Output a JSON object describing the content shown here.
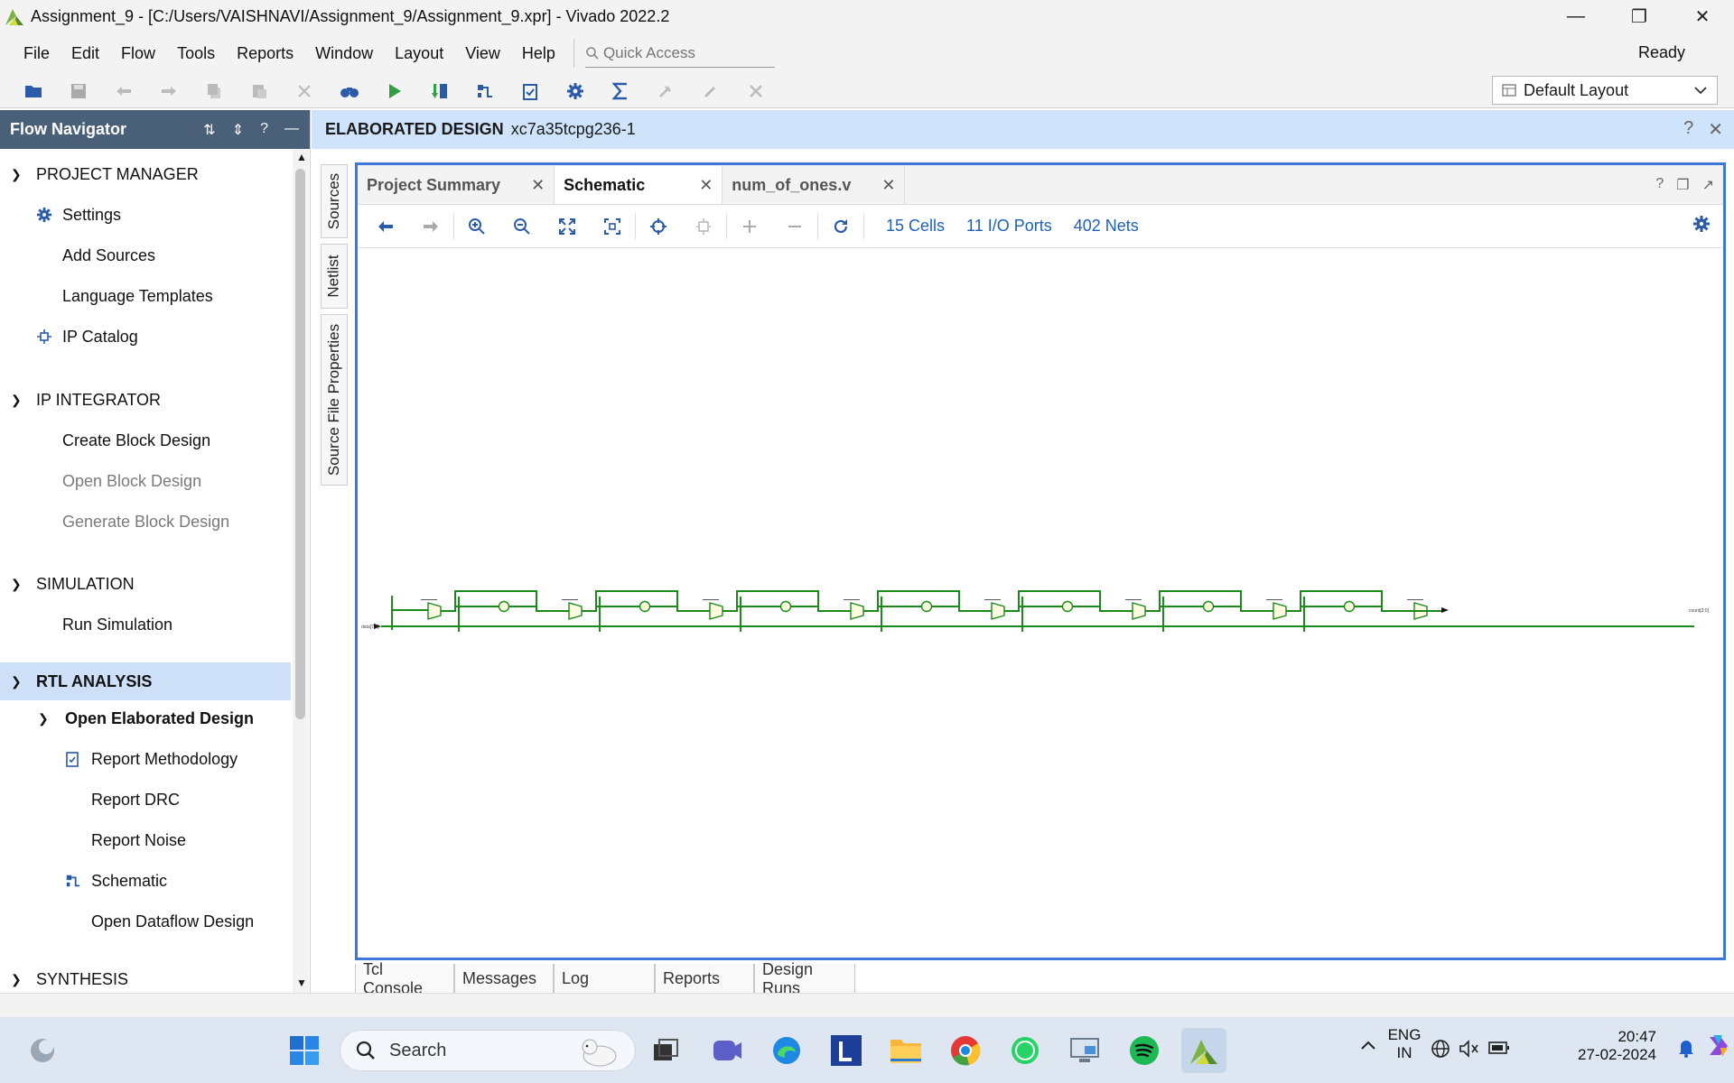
{
  "window": {
    "title": "Assignment_9 - [C:/Users/VAISHNAVI/Assignment_9/Assignment_9.xpr] - Vivado 2022.2"
  },
  "menu": [
    "File",
    "Edit",
    "Flow",
    "Tools",
    "Reports",
    "Window",
    "Layout",
    "View",
    "Help"
  ],
  "quick_access": {
    "placeholder": "Quick Access"
  },
  "status": "Ready",
  "layout_select": {
    "value": "Default Layout"
  },
  "flow_navigator": {
    "title": "Flow Navigator",
    "sections": {
      "project_manager": {
        "label": "PROJECT MANAGER",
        "items": [
          "Settings",
          "Add Sources",
          "Language Templates",
          "IP Catalog"
        ]
      },
      "ip_integrator": {
        "label": "IP INTEGRATOR",
        "items": [
          "Create Block Design",
          "Open Block Design",
          "Generate Block Design"
        ]
      },
      "simulation": {
        "label": "SIMULATION",
        "items": [
          "Run Simulation"
        ]
      },
      "rtl_analysis": {
        "label": "RTL ANALYSIS",
        "sub": "Open Elaborated Design",
        "items": [
          "Report Methodology",
          "Report DRC",
          "Report Noise",
          "Schematic",
          "Open Dataflow Design"
        ]
      },
      "synthesis": {
        "label": "SYNTHESIS"
      }
    }
  },
  "elaborated": {
    "title": "ELABORATED DESIGN",
    "part": "xc7a35tcpg236-1"
  },
  "side_tabs": [
    "Sources",
    "Netlist",
    "Source File Properties"
  ],
  "editor_tabs": [
    "Project Summary",
    "Schematic",
    "num_of_ones.v"
  ],
  "schematic_stats": {
    "cells": "15 Cells",
    "ports": "11 I/O Ports",
    "nets": "402 Nets"
  },
  "schematic": {
    "input_port": "data[7:0]",
    "output_port": "count[3:0]"
  },
  "bottom_tabs": [
    "Tcl Console",
    "Messages",
    "Log",
    "Reports",
    "Design Runs"
  ],
  "taskbar": {
    "search": "Search",
    "lang1": "ENG",
    "lang2": "IN",
    "time": "20:47",
    "date": "27-02-2024"
  },
  "colors": {
    "accent": "#3c78d8",
    "nav_header": "#4a6078",
    "net": "#1a8a1a",
    "selection": "#cde0f7"
  }
}
